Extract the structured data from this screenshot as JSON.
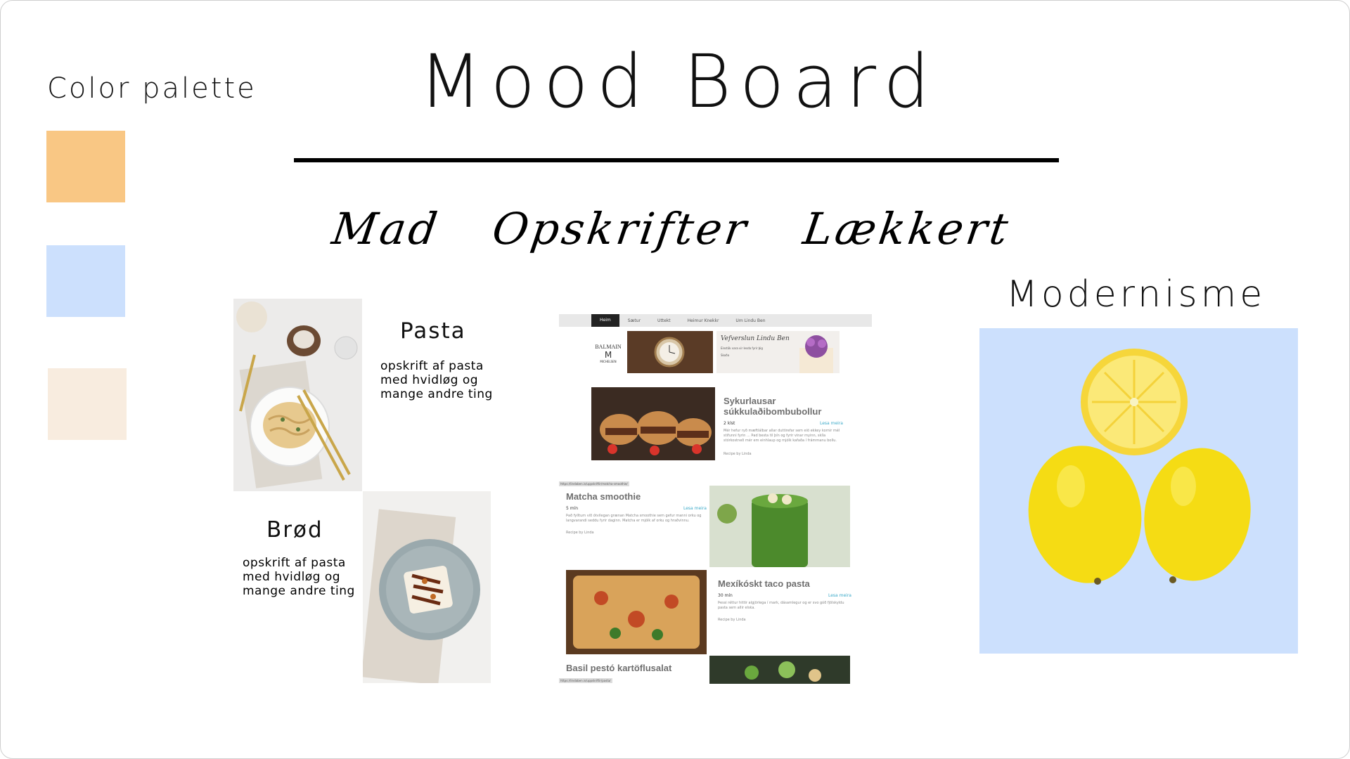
{
  "board": {
    "title": "Mood Board",
    "palette_title": "Color palette",
    "palette_colors": [
      "#f9c784",
      "#cce0fd",
      "#f8ecdf"
    ],
    "keywords": [
      "Mad",
      "Opskrifter",
      "Lækkert"
    ],
    "style_label": "Modernisme"
  },
  "cards": {
    "pasta": {
      "title": "Pasta",
      "body": "opskrift af pasta med hvidløg og mange andre ting"
    },
    "bread": {
      "title": "Brød",
      "body": "opskrift af pasta med hvidløg og mange andre ting"
    }
  },
  "screenshot": {
    "nav": [
      "Heim",
      "Sætur",
      "Uttekt",
      "Heimur Knekkr",
      "Um Lindu Ben"
    ],
    "ad_brand": "BALMAIN",
    "ad_sub": "MICHELSEN",
    "banner_text": "Vefverslun Lindu Ben",
    "banner_sub": "Einstök vara vir lesda fyrir þig",
    "banner_cta": "Skoða",
    "recipes": [
      {
        "title": "Sykurlausar súkkulaðibombubollur",
        "time": "2 klst",
        "text": "Mér hefur ryð mæftlálbar allar duttirefar sem eiö ekkey kornir mél stifunni fyrin ... Þad besta til þín og fyrir vinar myinn, skíla stórkostneð mér em einhlaup og mjólk kafaða í frámmanu bollu.",
        "by": "Recipe by Linda",
        "read": "Lesa meira"
      },
      {
        "title": "Matcha smoothie",
        "time": "5 mín",
        "text": "Það fylltum við ótvilegan grænan Matcha smoothie sem gefur manni orku og langvarandi seddu fyrir daginn. Matcha er mjólk af orku og hraðvinnu.",
        "by": "Recipe by Linda",
        "read": "Lesa meira"
      },
      {
        "title": "Mexíkóskt taco pasta",
        "time": "30 mín",
        "text": "Þessi réttur hittir algjörlega í mark, dásamlegur og er svo góð fjölskyldu pasta sem allir elska.",
        "by": "Recipe by Linda",
        "read": "Lesa meira"
      },
      {
        "title": "Basil pestó kartöflusalat",
        "time": "",
        "text": "",
        "by": "",
        "read": ""
      }
    ],
    "urls": [
      "https://lindaben.is/uppskriftir/matcha-smoothie/",
      "https://lindaben.is/uppskriftir/pasta/"
    ]
  }
}
